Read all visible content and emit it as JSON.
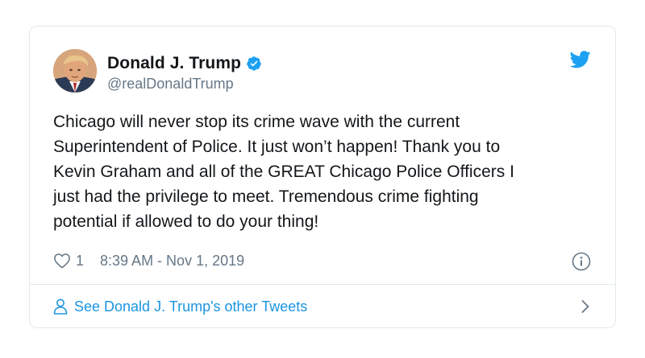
{
  "tweet": {
    "author_name": "Donald J. Trump",
    "handle": "@realDonaldTrump",
    "text": "Chicago will never stop its crime wave with the current\nSuperintendent of Police. It just won’t happen! Thank you to\nKevin Graham and all of the GREAT Chicago Police Officers I\njust had the privilege to meet. Tremendous crime fighting\npotential if allowed to do your thing!",
    "like_count": "1",
    "timestamp": "8:39 AM - Nov 1, 2019"
  },
  "footer": {
    "label": "See Donald J. Trump's other Tweets"
  },
  "icons": {
    "verified": "verified-badge-icon",
    "brand": "twitter-bird-icon",
    "like": "heart-icon",
    "info": "info-icon",
    "person": "person-icon",
    "chevron": "chevron-right-icon"
  },
  "colors": {
    "brand_blue": "#1da1f2",
    "link_blue": "#1b95e0",
    "text": "#14171a",
    "muted": "#657786",
    "border": "#e1e8ed"
  }
}
